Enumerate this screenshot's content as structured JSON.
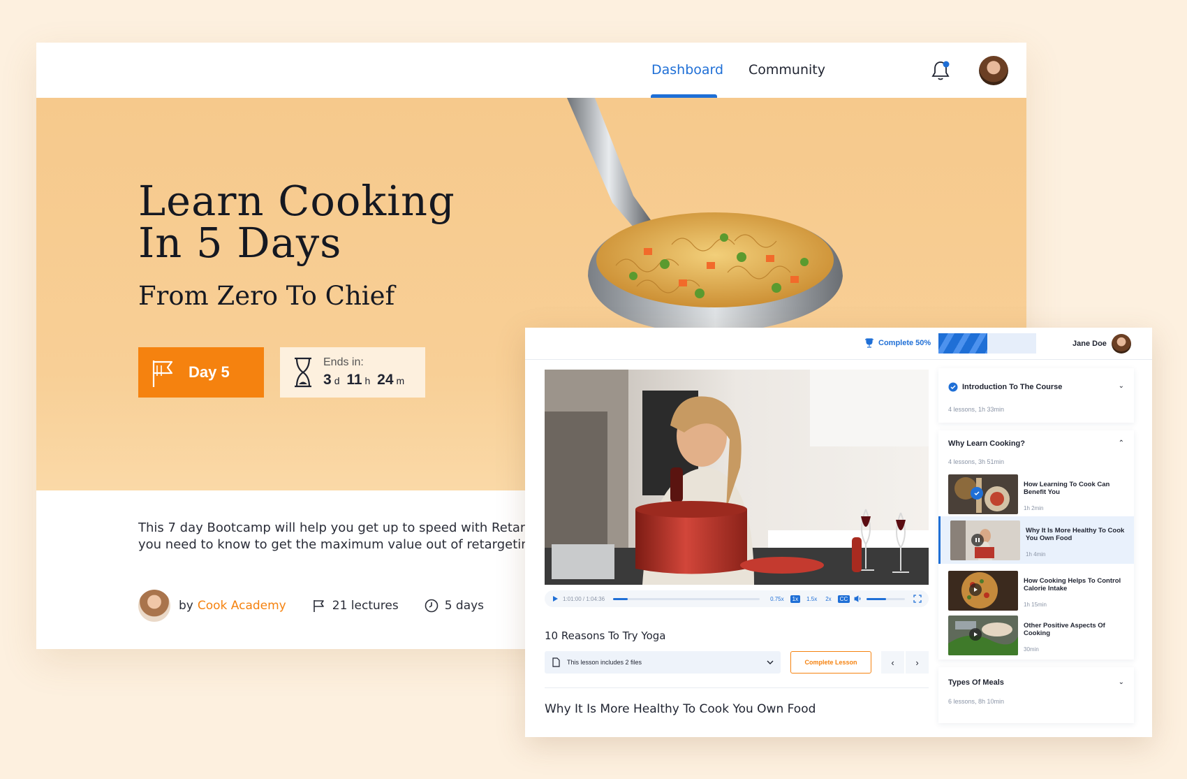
{
  "landing": {
    "nav": {
      "dashboard": "Dashboard",
      "community": "Community"
    },
    "hero": {
      "title_line1": "Learn Cooking",
      "title_line2": "In 5 Days",
      "subtitle": "From Zero To Chief",
      "day_label": "Day 5",
      "ends_label": "Ends in:",
      "countdown": {
        "days": "3",
        "days_unit": "d",
        "hours": "11",
        "hours_unit": "h",
        "minutes": "24",
        "minutes_unit": "m"
      }
    },
    "description_line1": "This 7 day Bootcamp will help you get up to speed with Retarget by",
    "description_line2": "you need to know to get the maximum value out of retargeting.",
    "meta": {
      "by": "by",
      "org": "Cook Academy",
      "lectures": "21 lectures",
      "duration": "5 days"
    }
  },
  "player": {
    "complete_label": "Complete 50%",
    "progress": 0.5,
    "user_name": "Jane Doe",
    "video": {
      "time": "1:01:00 / 1:04:36",
      "played": 0.1,
      "speeds": [
        "0.75x",
        "1x",
        "1.5x",
        "2x"
      ],
      "selected_speed": "1x",
      "cc": "CC",
      "volume": 0.5
    },
    "lesson_title": "10 Reasons To Try Yoga",
    "files_label": "This lesson includes 2 files",
    "complete_button": "Complete Lesson",
    "current_lesson": "Why It Is More Healthy To Cook You Own Food",
    "sections": [
      {
        "title": "Introduction To The Course",
        "meta": "4 lessons, 1h 33min"
      },
      {
        "title": "Why Learn Cooking?",
        "meta": "4 lessons, 3h 51min",
        "lessons": [
          {
            "title": "How Learning To Cook Can Benefit You",
            "duration": "1h 2min",
            "state": "completed"
          },
          {
            "title": "Why It Is More Healthy To Cook You Own Food",
            "duration": "1h 4min",
            "state": "playing"
          },
          {
            "title": "How Cooking Helps To Control Calorie Intake",
            "duration": "1h 15min",
            "state": "play"
          },
          {
            "title": "Other Positive Aspects Of Cooking",
            "duration": "30min",
            "state": "play"
          }
        ]
      },
      {
        "title": "Types Of Meals",
        "meta": "6 lessons, 8h 10min"
      }
    ]
  },
  "colors": {
    "accent": "#1f6fd6",
    "orange": "#f5820f",
    "background": "#fdf0df",
    "hero": "#f7ca90"
  }
}
